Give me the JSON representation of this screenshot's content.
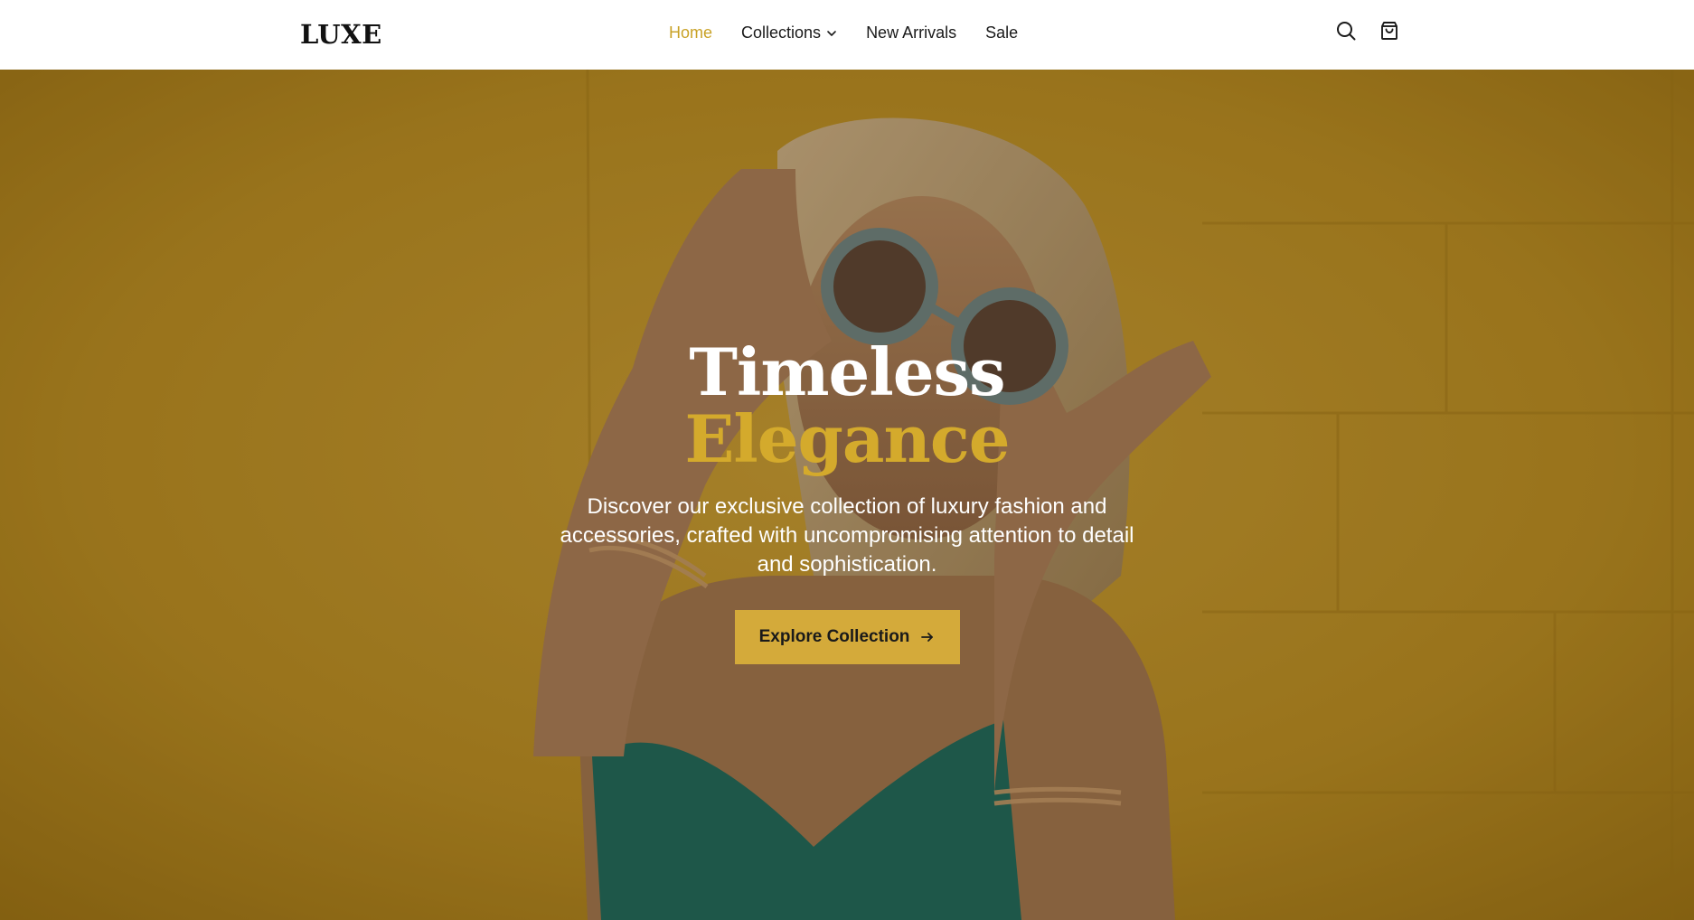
{
  "header": {
    "logo": "LUXE",
    "nav": [
      {
        "label": "Home",
        "active": true
      },
      {
        "label": "Collections",
        "has_dropdown": true
      },
      {
        "label": "New Arrivals"
      },
      {
        "label": "Sale"
      }
    ],
    "icons": [
      "search-icon",
      "shopping-bag-icon"
    ]
  },
  "hero": {
    "title_line1": "Timeless",
    "title_line2": "Elegance",
    "subtitle": "Discover our exclusive collection of luxury fashion and accessories, crafted with uncompromising attention to detail and sophistication.",
    "cta_label": "Explore Collection",
    "cta_icon": "arrow-right-icon",
    "background": "hero-photo"
  },
  "colors": {
    "accent": "#d4aa3a",
    "nav_active": "#c9a227",
    "hero_background": "#c99d2a",
    "text_dark": "#1a1a1a"
  }
}
